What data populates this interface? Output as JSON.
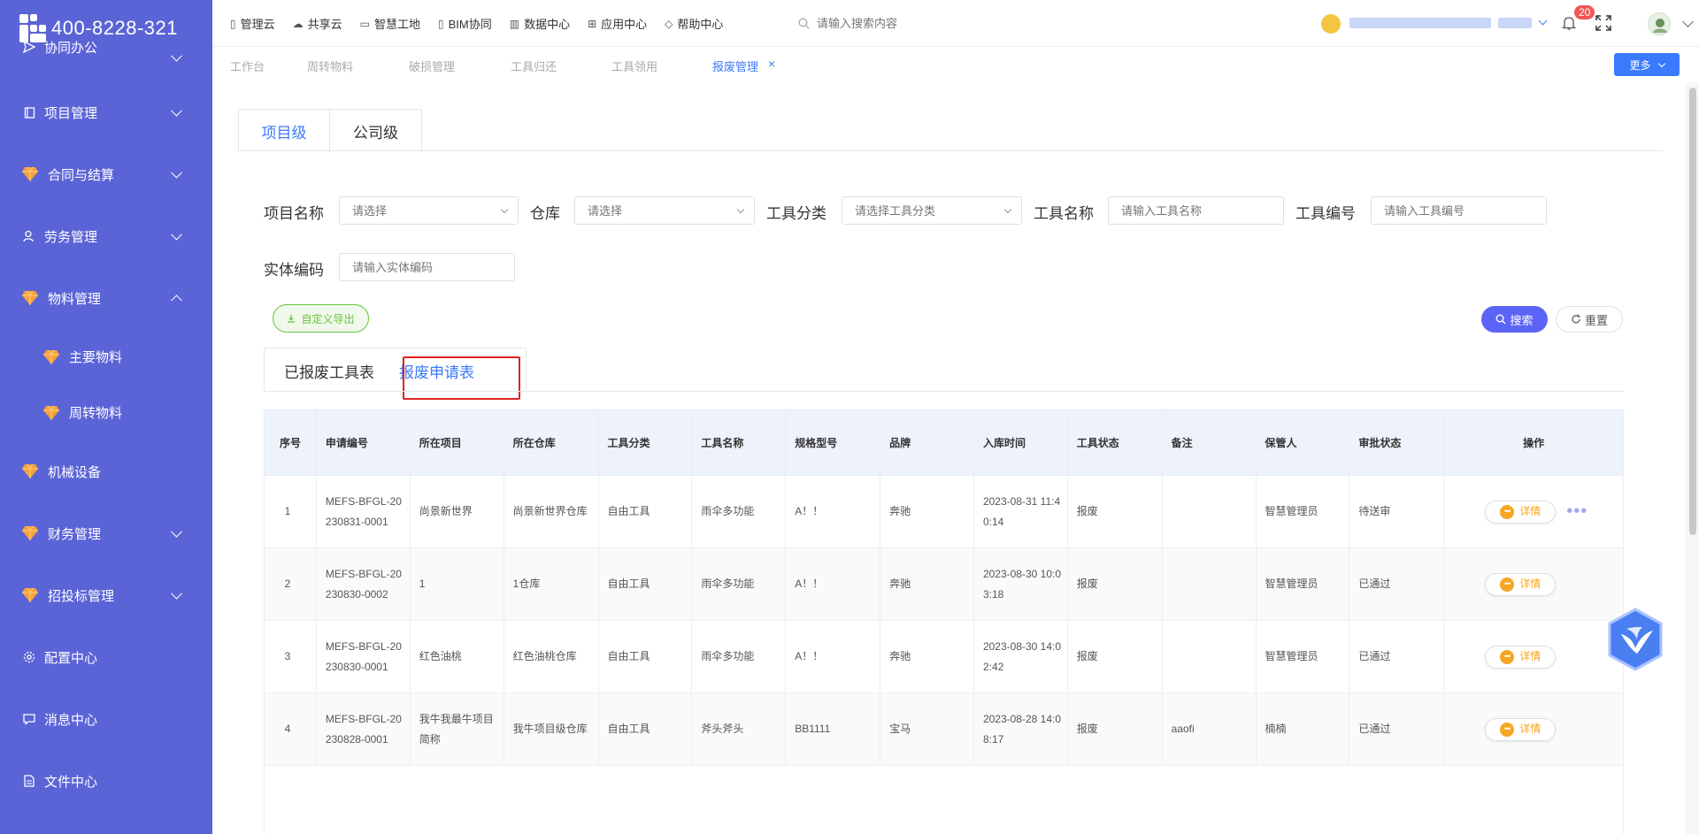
{
  "sidebar": {
    "phone": "400-8228-321",
    "menu": [
      {
        "label": "协同办公",
        "icon": "send-icon"
      },
      {
        "label": "项目管理",
        "icon": "book-icon"
      },
      {
        "label": "合同与结算",
        "icon": "gem-icon"
      },
      {
        "label": "劳务管理",
        "icon": "user-icon"
      },
      {
        "label": "物料管理",
        "icon": "gem-icon"
      },
      {
        "label": "主要物料",
        "icon": "gem-icon"
      },
      {
        "label": "周转物料",
        "icon": "gem-icon"
      },
      {
        "label": "机械设备",
        "icon": "gem-icon"
      },
      {
        "label": "财务管理",
        "icon": "gem-icon"
      },
      {
        "label": "招投标管理",
        "icon": "gem-icon"
      },
      {
        "label": "配置中心",
        "icon": "gear-icon"
      },
      {
        "label": "消息中心",
        "icon": "message-icon"
      },
      {
        "label": "文件中心",
        "icon": "file-icon"
      }
    ]
  },
  "topnav": {
    "items": [
      "管理云",
      "共享云",
      "智慧工地",
      "BIM协同",
      "数据中心",
      "应用中心",
      "帮助中心"
    ],
    "search_placeholder": "请输入搜索内容",
    "badge_count": "20"
  },
  "page_tabs": {
    "items": [
      "工作台",
      "周转物料",
      "破损管理",
      "工具归还",
      "工具领用",
      "报废管理"
    ],
    "close": "×",
    "more_label": "更多"
  },
  "level_tabs": [
    "项目级",
    "公司级"
  ],
  "filters": {
    "project_label": "项目名称",
    "project_placeholder": "请选择",
    "warehouse_label": "仓库",
    "warehouse_placeholder": "请选择",
    "category_label": "工具分类",
    "category_placeholder": "请选择工具分类",
    "tool_name_label": "工具名称",
    "tool_name_placeholder": "请输入工具名称",
    "tool_no_label": "工具编号",
    "tool_no_placeholder": "请输入工具编号",
    "entity_label": "实体编码",
    "entity_placeholder": "请输入实体编码"
  },
  "actions": {
    "export": "自定义导出",
    "search": "搜索",
    "reset": "重置"
  },
  "sub_tabs": [
    "已报废工具表",
    "报废申请表"
  ],
  "table": {
    "headers": [
      "序号",
      "申请编号",
      "所在项目",
      "所在仓库",
      "工具分类",
      "工具名称",
      "规格型号",
      "品牌",
      "入库时间",
      "工具状态",
      "备注",
      "保管人",
      "审批状态",
      "操作"
    ],
    "detail_label": "详情",
    "rows": [
      {
        "no": "1",
        "code": "MEFS-BFGL-20230831-0001",
        "project": "尚景新世界",
        "warehouse": "尚景新世界仓库",
        "category": "自由工具",
        "name": "雨伞多功能",
        "spec": "A！！",
        "brand": "奔驰",
        "time": "2023-08-31 11:40:14",
        "status": "报废",
        "remark": "",
        "keeper": "智慧管理员",
        "approval": "待送审"
      },
      {
        "no": "2",
        "code": "MEFS-BFGL-20230830-0002",
        "project": "1",
        "warehouse": "1仓库",
        "category": "自由工具",
        "name": "雨伞多功能",
        "spec": "A！！",
        "brand": "奔驰",
        "time": "2023-08-30 10:03:18",
        "status": "报废",
        "remark": "",
        "keeper": "智慧管理员",
        "approval": "已通过"
      },
      {
        "no": "3",
        "code": "MEFS-BFGL-20230830-0001",
        "project": "红色油桃",
        "warehouse": "红色油桃仓库",
        "category": "自由工具",
        "name": "雨伞多功能",
        "spec": "A！！",
        "brand": "奔驰",
        "time": "2023-08-30 14:02:42",
        "status": "报废",
        "remark": "",
        "keeper": "智慧管理员",
        "approval": "已通过"
      },
      {
        "no": "4",
        "code": "MEFS-BFGL-20230828-0001",
        "project": "我牛我最牛项目简称",
        "warehouse": "我牛项目级仓库",
        "category": "自由工具",
        "name": "斧头斧头",
        "spec": "BB1111",
        "brand": "宝马",
        "time": "2023-08-28 14:08:17",
        "status": "报废",
        "remark": "aaofi",
        "keeper": "楠楠",
        "approval": "已通过"
      }
    ]
  }
}
